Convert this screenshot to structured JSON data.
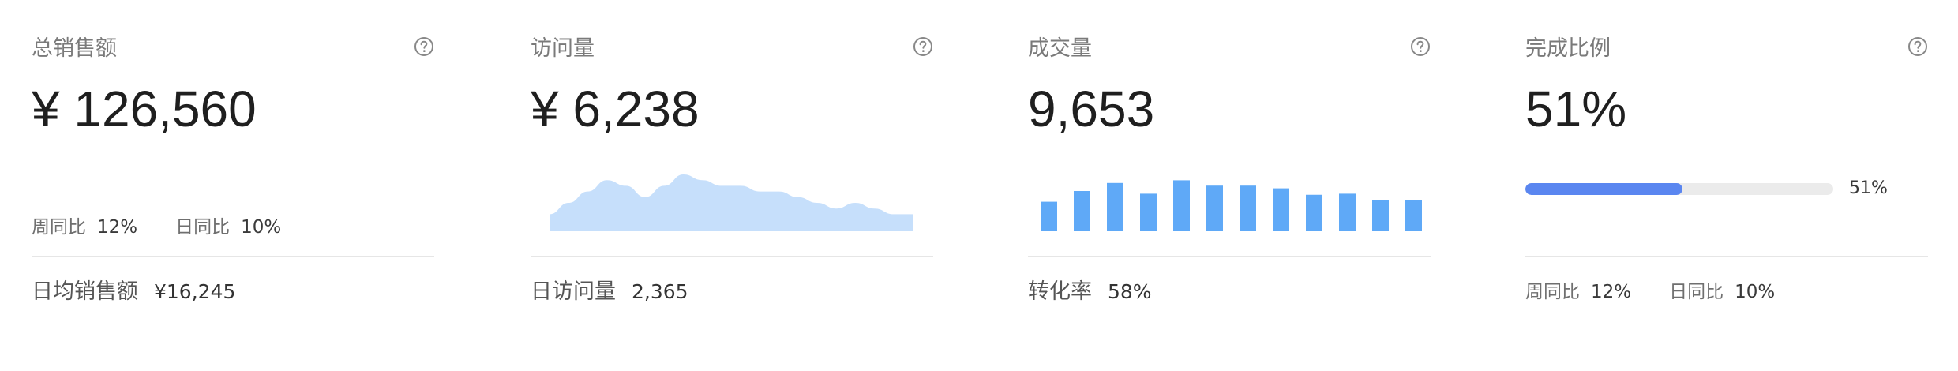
{
  "cards": [
    {
      "title": "总销售额",
      "value": "¥ 126,560",
      "week_label": "周同比",
      "week_value": "12%",
      "day_label": "日同比",
      "day_value": "10%",
      "footer_label": "日均销售额",
      "footer_value": "¥16,245"
    },
    {
      "title": "访问量",
      "value": "¥ 6,238",
      "footer_label": "日访问量",
      "footer_value": "2,365",
      "area_values": [
        3,
        5,
        7,
        9,
        8,
        6,
        8,
        10,
        9,
        8,
        8,
        7,
        7,
        6,
        5,
        4,
        5,
        4,
        3,
        3
      ],
      "area_color": "#c6dffb"
    },
    {
      "title": "成交量",
      "value": "9,653",
      "footer_label": "转化率",
      "footer_value": "58%",
      "bar_values": [
        5.5,
        7.5,
        9,
        7,
        9.5,
        8.5,
        8.5,
        8,
        6.8,
        7,
        5.8,
        5.8
      ],
      "bar_color": "#5fa9f7"
    },
    {
      "title": "完成比例",
      "value": "51%",
      "progress_percent": 51,
      "progress_label": "51%",
      "progress_color": "#5a86f0",
      "week_label": "周同比",
      "week_value": "12%",
      "day_label": "日同比",
      "day_value": "10%"
    }
  ],
  "help_icon": "question-circle-icon"
}
